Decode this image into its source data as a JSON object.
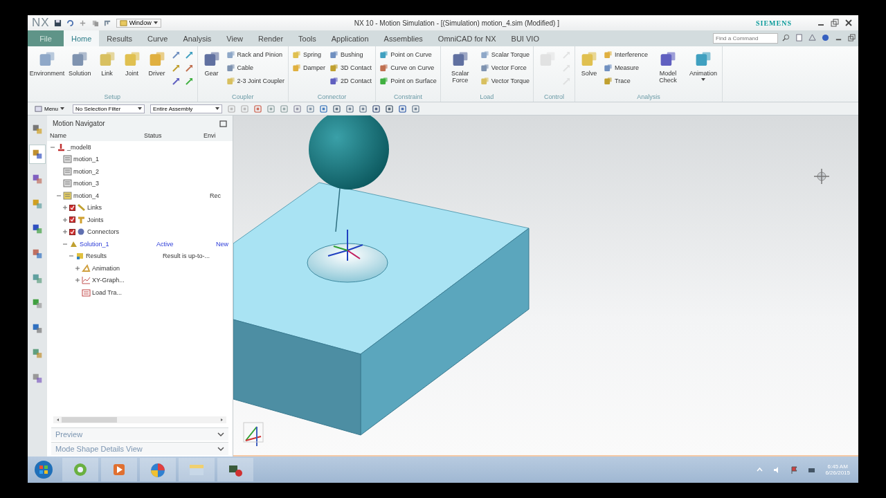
{
  "title_bar": {
    "app_mark": "NX",
    "window_menu": "Window",
    "title": "NX 10 - Motion Simulation - [(Simulation) motion_4.sim (Modified) ]",
    "brand": "SIEMENS"
  },
  "ribbon_tabs": [
    {
      "label": "File",
      "kind": "file",
      "selected": false
    },
    {
      "label": "Home",
      "kind": "tab",
      "selected": true
    },
    {
      "label": "Results",
      "kind": "tab",
      "selected": false
    },
    {
      "label": "Curve",
      "kind": "tab",
      "selected": false
    },
    {
      "label": "Analysis",
      "kind": "tab",
      "selected": false
    },
    {
      "label": "View",
      "kind": "tab",
      "selected": false
    },
    {
      "label": "Render",
      "kind": "tab",
      "selected": false
    },
    {
      "label": "Tools",
      "kind": "tab",
      "selected": false
    },
    {
      "label": "Application",
      "kind": "tab",
      "selected": false
    },
    {
      "label": "Assemblies",
      "kind": "tab",
      "selected": false
    },
    {
      "label": "OmniCAD for NX",
      "kind": "tab",
      "selected": false
    },
    {
      "label": "BUI VIO",
      "kind": "tab",
      "selected": false
    }
  ],
  "search": {
    "placeholder": "Find a Command"
  },
  "ribbon_groups": [
    {
      "label": "Setup",
      "items": [
        {
          "kind": "large",
          "label": "Environment"
        },
        {
          "kind": "large",
          "label": "Solution"
        },
        {
          "kind": "large",
          "label": "Link"
        },
        {
          "kind": "large",
          "label": "Joint"
        },
        {
          "kind": "large",
          "label": "Driver"
        },
        {
          "kind": "stack",
          "tools": [
            {
              "kind": "icon"
            },
            {
              "kind": "icon"
            },
            {
              "kind": "icon"
            }
          ]
        },
        {
          "kind": "stack",
          "tools": [
            {
              "kind": "icon"
            },
            {
              "kind": "icon"
            },
            {
              "kind": "icon"
            }
          ]
        }
      ]
    },
    {
      "label": "Coupler",
      "items": [
        {
          "kind": "large",
          "label": "Gear"
        },
        {
          "kind": "stack",
          "tools": [
            {
              "label": "Rack and Pinion"
            },
            {
              "label": "Cable"
            },
            {
              "label": "2-3 Joint Coupler"
            }
          ]
        }
      ]
    },
    {
      "label": "Connector",
      "items": [
        {
          "kind": "stack",
          "tools": [
            {
              "label": "Spring"
            },
            {
              "label": "Damper"
            }
          ]
        },
        {
          "kind": "stack",
          "tools": [
            {
              "label": "Bushing"
            },
            {
              "label": "3D Contact"
            },
            {
              "label": "2D Contact"
            }
          ]
        }
      ]
    },
    {
      "label": "Constraint",
      "items": [
        {
          "kind": "stack",
          "tools": [
            {
              "label": "Point on Curve"
            },
            {
              "label": "Curve on Curve"
            },
            {
              "label": "Point on Surface"
            }
          ]
        }
      ]
    },
    {
      "label": "Load",
      "items": [
        {
          "kind": "large",
          "label": "Scalar Force"
        },
        {
          "kind": "stack",
          "tools": [
            {
              "label": "Scalar Torque"
            },
            {
              "label": "Vector Force"
            },
            {
              "label": "Vector Torque"
            }
          ]
        }
      ]
    },
    {
      "label": "Control",
      "items": [
        {
          "kind": "large",
          "disabled": true
        },
        {
          "kind": "stack",
          "tools": [
            {
              "kind": "icon",
              "disabled": true
            },
            {
              "kind": "icon",
              "disabled": true
            },
            {
              "kind": "icon",
              "disabled": true
            }
          ]
        }
      ]
    },
    {
      "label": "Analysis",
      "items": [
        {
          "kind": "large",
          "label": "Solve"
        },
        {
          "kind": "stack",
          "tools": [
            {
              "label": "Interference"
            },
            {
              "label": "Measure"
            },
            {
              "label": "Trace"
            }
          ]
        },
        {
          "kind": "large",
          "label": "Model Check"
        },
        {
          "kind": "large",
          "label": "Animation",
          "menu": true
        }
      ]
    }
  ],
  "toolbar": {
    "menu_button": "Menu",
    "selection_filter": "No Selection Filter",
    "scope": "Entire Assembly"
  },
  "resource_bar": [
    {
      "selected": false
    },
    {
      "selected": true
    },
    {
      "selected": false
    },
    {
      "selected": false
    },
    {
      "selected": false
    },
    {
      "selected": false
    },
    {
      "selected": false
    },
    {
      "selected": false
    },
    {
      "selected": false
    },
    {
      "selected": false
    },
    {
      "selected": false
    }
  ],
  "navigator": {
    "title": "Motion Navigator",
    "columns": [
      "Name",
      "Status",
      "Envi"
    ],
    "tree": [
      {
        "name": "_model8",
        "kind": "model",
        "expanded": true,
        "children": [
          {
            "name": "motion_1",
            "kind": "sim"
          },
          {
            "name": "motion_2",
            "kind": "sim"
          },
          {
            "name": "motion_3",
            "kind": "sim"
          },
          {
            "name": "motion_4",
            "kind": "motion",
            "env": "Rec",
            "expanded": true,
            "children": [
              {
                "name": "Links",
                "kind": "link",
                "checked": true,
                "expanded": false
              },
              {
                "name": "Joints",
                "kind": "joint",
                "checked": true,
                "expanded": false
              },
              {
                "name": "Connectors",
                "kind": "connector",
                "checked": true,
                "expanded": false
              },
              {
                "name": "Solution_1",
                "kind": "solution",
                "status": "Active",
                "env": "New",
                "active": true,
                "expanded": true,
                "children": [
                  {
                    "name": "Results",
                    "kind": "results",
                    "status": "Result is up-to-...",
                    "expanded": true,
                    "children": [
                      {
                        "name": "Animation",
                        "kind": "animation",
                        "expanded": false
                      },
                      {
                        "name": "XY-Graph...",
                        "kind": "graph",
                        "expanded": false
                      },
                      {
                        "name": "Load Tra...",
                        "kind": "load"
                      }
                    ]
                  }
                ]
              }
            ]
          }
        ]
      }
    ],
    "panels": [
      {
        "label": "Preview",
        "expanded": false
      },
      {
        "label": "Mode Shape Details View",
        "expanded": false
      }
    ]
  },
  "taskbar": {
    "time": "6:45 AM",
    "date": "6/26/2015"
  }
}
